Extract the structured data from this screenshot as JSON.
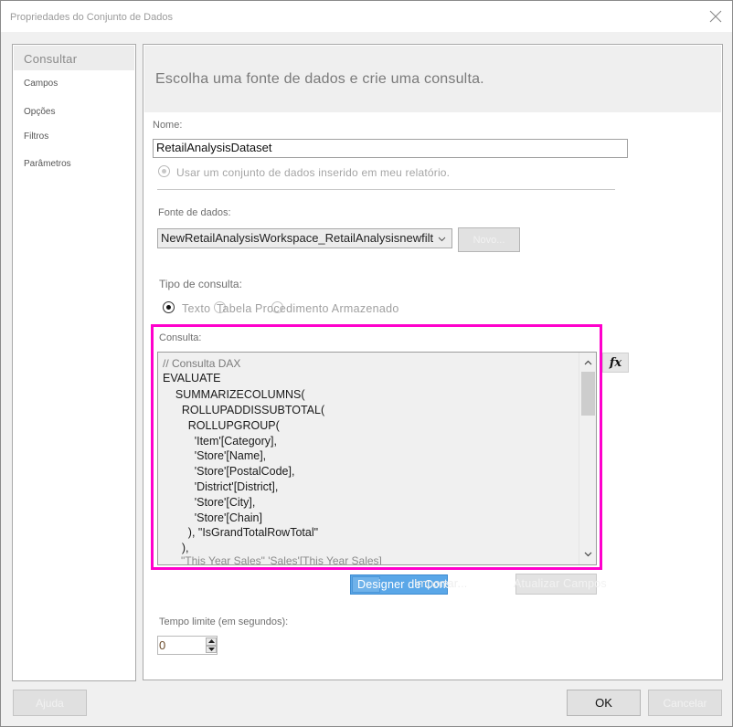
{
  "window": {
    "title": "Propriedades do Conjunto de Dados",
    "close_icon": "close-icon"
  },
  "nav": {
    "items": [
      {
        "label": "Consultar",
        "selected": true
      },
      {
        "label": "Campos"
      },
      {
        "label": "Opções"
      },
      {
        "label": "Filtros"
      },
      {
        "label": "Parâmetros"
      }
    ]
  },
  "main": {
    "header": "Escolha uma fonte de dados e crie uma consulta.",
    "name_label": "Nome:",
    "name_value": "RetailAnalysisDataset",
    "embedded_radio_label": "Usar um conjunto de dados inserido em meu relatório.",
    "datasource_label": "Fonte de dados:",
    "datasource_value": "NewRetailAnalysisWorkspace_RetailAnalysisnewfiltersst",
    "new_button": "Novo...",
    "query_type_label": "Tipo de consulta:",
    "query_types": [
      {
        "label": "Texto",
        "selected": true
      },
      {
        "label": "Tabela",
        "selected": false
      },
      {
        "label": "Procedimento Armazenado",
        "selected": false
      }
    ],
    "query_label": "Consulta:",
    "query_lines": [
      "// Consulta DAX",
      "EVALUATE",
      "    SUMMARIZECOLUMNS(",
      "      ROLLUPADDISSUBTOTAL(",
      "        ROLLUPGROUP(",
      "          'Item'[Category],",
      "          'Store'[Name],",
      "          'Store'[PostalCode],",
      "          'District'[District],",
      "          'Store'[City],",
      "          'Store'[Chain]",
      "        ), \"IsGrandTotalRowTotal\"",
      "      ),",
      "      \"This Year Sales\" 'Sales'[This Year Sales]"
    ],
    "fx_button": "fx",
    "designer_button": "Designer de Consulta",
    "import_button": "Importar...",
    "refresh_fields_button": "Atualizar Campos",
    "timeout_label": "Tempo limite (em segundos):",
    "timeout_value": "0"
  },
  "footer": {
    "help_button": "Ajuda",
    "ok_button": "OK",
    "cancel_button": "Cancelar"
  },
  "colors": {
    "highlight": "#ff00cc",
    "designer_button_bg": "#5aa7e8"
  }
}
